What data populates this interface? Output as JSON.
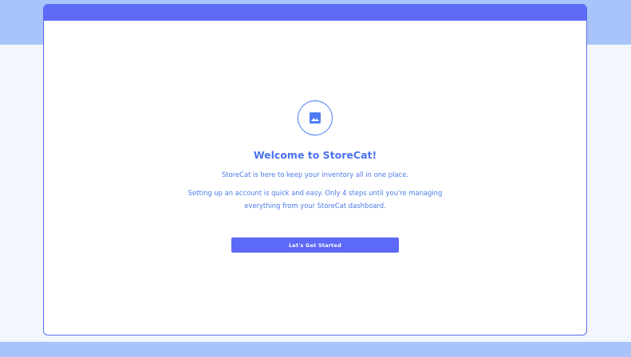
{
  "welcome": {
    "icon": "image-icon",
    "title": "Welcome to StoreCat!",
    "line1": "StoreCat is here to keep your inventory all in one place.",
    "line2": "Setting up an account is quick and easy. Only 4 steps until you're managing everything from your StoreCat dashboard."
  },
  "cta": {
    "label": "Let's Get Started"
  },
  "colors": {
    "accent": "#5f6bf7",
    "band": "#a8c4fa",
    "background": "#f3f6fd",
    "text": "#4b72ee"
  }
}
